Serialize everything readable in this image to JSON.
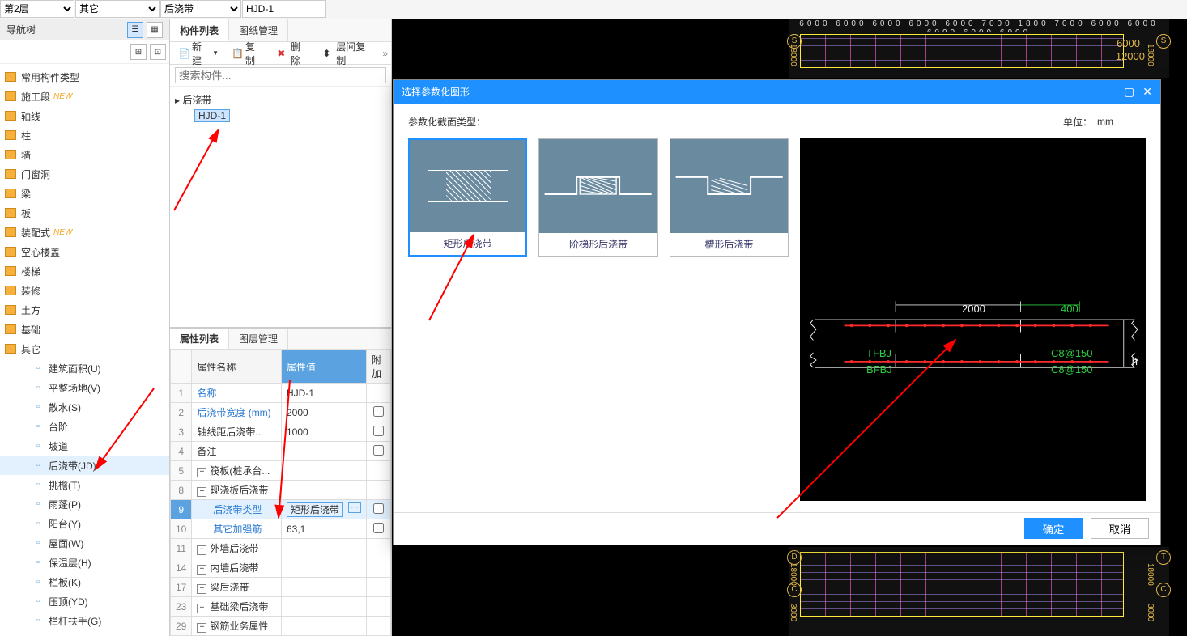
{
  "topbar": {
    "floor": "第2层",
    "category": "其它",
    "component_type": "后浇带",
    "instance": "HJD-1"
  },
  "nav": {
    "title": "导航树",
    "items": [
      {
        "label": "常用构件类型"
      },
      {
        "label": "施工段",
        "new": "NEW"
      },
      {
        "label": "轴线"
      },
      {
        "label": "柱"
      },
      {
        "label": "墙"
      },
      {
        "label": "门窗洞"
      },
      {
        "label": "梁"
      },
      {
        "label": "板"
      },
      {
        "label": "装配式",
        "new": "NEW"
      },
      {
        "label": "空心楼盖"
      },
      {
        "label": "楼梯"
      },
      {
        "label": "装修"
      },
      {
        "label": "土方"
      },
      {
        "label": "基础"
      },
      {
        "label": "其它",
        "expanded": true
      }
    ],
    "subitems": [
      {
        "label": "建筑面积(U)"
      },
      {
        "label": "平整场地(V)"
      },
      {
        "label": "散水(S)"
      },
      {
        "label": "台阶"
      },
      {
        "label": "坡道"
      },
      {
        "label": "后浇带(JD)",
        "selected": true
      },
      {
        "label": "挑檐(T)"
      },
      {
        "label": "雨蓬(P)"
      },
      {
        "label": "阳台(Y)"
      },
      {
        "label": "屋面(W)"
      },
      {
        "label": "保温层(H)"
      },
      {
        "label": "栏板(K)"
      },
      {
        "label": "压顶(YD)"
      },
      {
        "label": "栏杆扶手(G)"
      }
    ]
  },
  "mid": {
    "tabs": [
      "构件列表",
      "图纸管理"
    ],
    "toolbar": {
      "new": "新建",
      "copy": "复制",
      "delete": "删除",
      "layer_copy": "层间复制"
    },
    "search_placeholder": "搜索构件...",
    "tree_root": "后浇带",
    "tree_item": "HJD-1"
  },
  "prop": {
    "tabs": [
      "属性列表",
      "图层管理"
    ],
    "cols": {
      "name": "属性名称",
      "value": "属性值",
      "attach": "附加"
    },
    "rows": [
      {
        "n": "1",
        "name": "名称",
        "value": "HJD-1",
        "blue": true
      },
      {
        "n": "2",
        "name": "后浇带宽度 (mm)",
        "value": "2000",
        "blue": true,
        "chk": true
      },
      {
        "n": "3",
        "name": "轴线距后浇带...",
        "value": "1000",
        "chk": true
      },
      {
        "n": "4",
        "name": "备注",
        "value": "",
        "chk": true
      },
      {
        "n": "5",
        "name": "筏板(桩承台...",
        "value": "",
        "expand": "+"
      },
      {
        "n": "8",
        "name": "现浇板后浇带",
        "value": "",
        "expand": "−"
      },
      {
        "n": "9",
        "name": "后浇带类型",
        "value": "矩形后浇带",
        "blue": true,
        "indent": true,
        "selected": true,
        "editable": true,
        "chk": true
      },
      {
        "n": "10",
        "name": "其它加强筋",
        "value": "63,1",
        "blue": true,
        "indent": true,
        "chk": true
      },
      {
        "n": "11",
        "name": "外墙后浇带",
        "value": "",
        "expand": "+"
      },
      {
        "n": "14",
        "name": "内墙后浇带",
        "value": "",
        "expand": "+"
      },
      {
        "n": "17",
        "name": "梁后浇带",
        "value": "",
        "expand": "+"
      },
      {
        "n": "23",
        "name": "基础梁后浇带",
        "value": "",
        "expand": "+"
      },
      {
        "n": "29",
        "name": "钢筋业务属性",
        "value": "",
        "expand": "+"
      }
    ]
  },
  "dialog": {
    "title": "选择参数化图形",
    "section_label": "参数化截面类型：",
    "unit_label": "单位：",
    "unit_value": "mm",
    "cards": [
      {
        "label": "矩形后浇带",
        "selected": true
      },
      {
        "label": "阶梯形后浇带"
      },
      {
        "label": "槽形后浇带"
      }
    ],
    "preview": {
      "w": "2000",
      "ext": "400",
      "h": "h",
      "tfbj": "TFBJ",
      "bfbj": "BFBJ",
      "tf_val": "C8@150",
      "bf_val": "C8@150"
    },
    "ok": "确定",
    "cancel": "取消"
  },
  "cad": {
    "ruler_top": "6000 6000 6000 6000 6000 7000 1800 7000 6000 6000 6000 6000 6000",
    "ruler_right1": "6000",
    "ruler_right2": "12000",
    "left18000": "18000",
    "left3000": "3000",
    "marker_s": "S",
    "marker_d": "D",
    "marker_c": "C",
    "marker_t": "T"
  }
}
